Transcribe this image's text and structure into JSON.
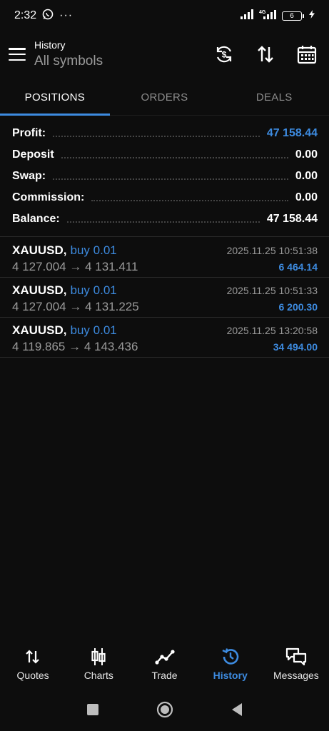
{
  "status_bar": {
    "time": "2:32",
    "battery": "6"
  },
  "header": {
    "title": "History",
    "subtitle": "All symbols"
  },
  "tabs": [
    {
      "label": "POSITIONS",
      "active": true
    },
    {
      "label": "ORDERS",
      "active": false
    },
    {
      "label": "DEALS",
      "active": false
    }
  ],
  "summary": {
    "profit": {
      "label": "Profit:",
      "value": "47 158.44"
    },
    "deposit": {
      "label": "Deposit",
      "value": "0.00"
    },
    "swap": {
      "label": "Swap:",
      "value": "0.00"
    },
    "commission": {
      "label": "Commission:",
      "value": "0.00"
    },
    "balance": {
      "label": "Balance:",
      "value": "47 158.44"
    }
  },
  "positions": [
    {
      "symbol": "XAUUSD,",
      "side": "buy 0.01",
      "date": "2025.11.25 10:51:38",
      "prices": "4 127.004 → 4 131.411",
      "profit": "6 464.14"
    },
    {
      "symbol": "XAUUSD,",
      "side": "buy 0.01",
      "date": "2025.11.25 10:51:33",
      "prices": "4 127.004 → 4 131.225",
      "profit": "6 200.30"
    },
    {
      "symbol": "XAUUSD,",
      "side": "buy 0.01",
      "date": "2025.11.25 13:20:58",
      "prices": "4 119.865 → 4 143.436",
      "profit": "34 494.00"
    }
  ],
  "bottom_nav": [
    {
      "label": "Quotes",
      "icon": "quotes-arrows-icon"
    },
    {
      "label": "Charts",
      "icon": "candlestick-icon"
    },
    {
      "label": "Trade",
      "icon": "trade-line-icon"
    },
    {
      "label": "History",
      "icon": "history-clock-icon",
      "active": true
    },
    {
      "label": "Messages",
      "icon": "chat-bubbles-icon"
    }
  ],
  "colors": {
    "accent": "#3d8be0",
    "background": "#0d0d0d",
    "muted": "#9a9a9a"
  }
}
